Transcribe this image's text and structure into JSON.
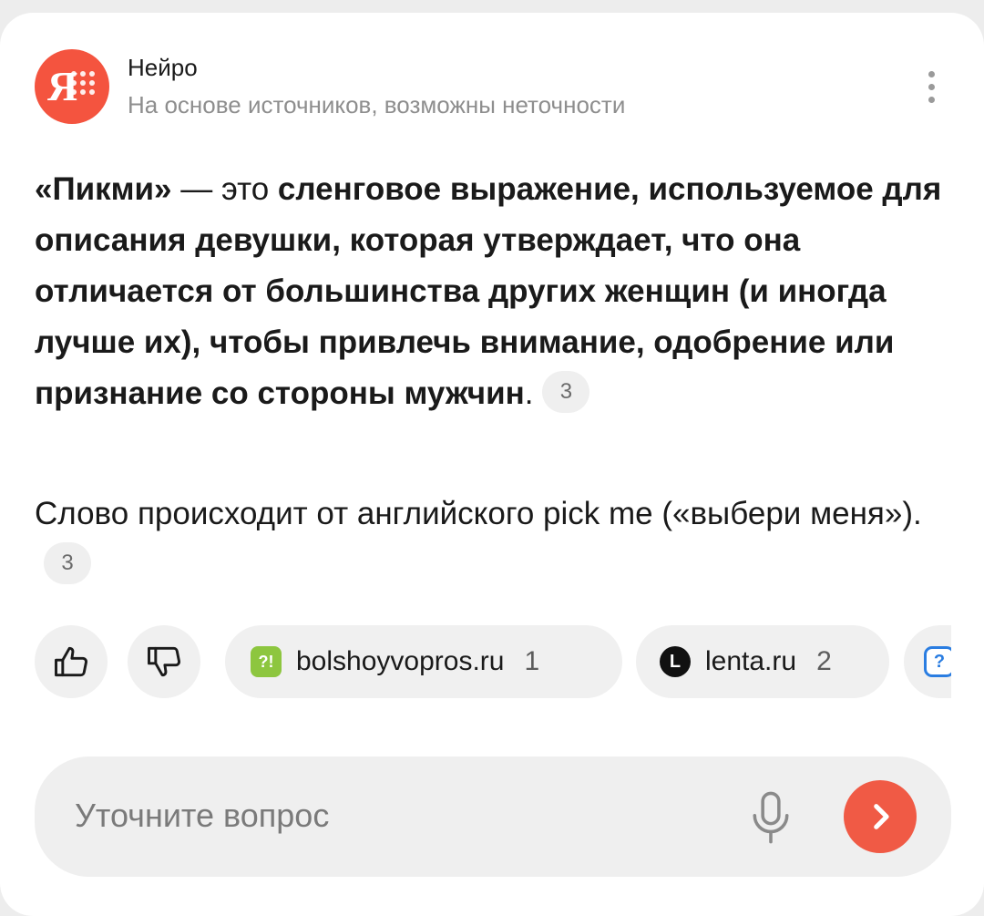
{
  "header": {
    "app_name": "Нейро",
    "subtitle": "На основе источников, возможны неточности",
    "logo_letter": "Я"
  },
  "answer": {
    "p1_quote": "«Пикми»",
    "p1_text1": " — это ",
    "p1_bold": "сленговое выражение, используемое для описания девушки, которая утверждает, что она отличается от большинства других женщин (и иногда лучше их), чтобы привлечь внимание, одобрение или признание со стороны мужчин",
    "p1_end": ".",
    "p1_ref": "3",
    "p2_text": "Слово происходит от английского pick me («выбери меня»).",
    "p2_ref": "3"
  },
  "sources": {
    "items": [
      {
        "label": "bolshoyvopros.ru",
        "count": "1",
        "icon": "bolshoyvopros-favicon"
      },
      {
        "label": "lenta.ru",
        "count": "2",
        "icon": "lenta-favicon"
      }
    ]
  },
  "input": {
    "placeholder": "Уточните вопрос"
  },
  "colors": {
    "accent": "#f4543f",
    "chip_bg": "#f0f0f0",
    "muted_text": "#8e8e8e"
  }
}
